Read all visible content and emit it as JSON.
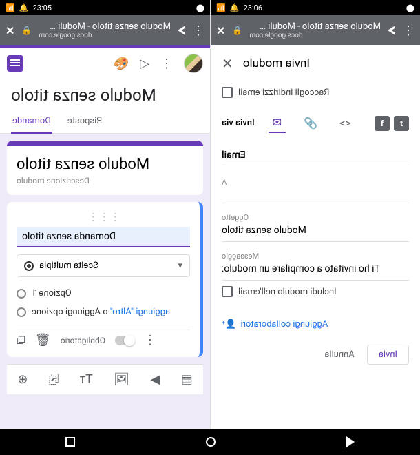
{
  "status": {
    "time_left": "23:06",
    "time_right": "23:05"
  },
  "browser": {
    "title": "Modulo senza titolo - Moduli …",
    "url": "docs.google.com"
  },
  "left": {
    "dialog_title": "Invia modulo",
    "collect_emails": "Raccogli indirizzi email",
    "send_via_label": "Invia via",
    "section": "Email",
    "to_label": "A",
    "to_value": "",
    "subject_label": "Oggetto",
    "subject_value": "Modulo senza titolo",
    "message_label": "Messaggio",
    "message_value": "Ti ho invitato a compilare un modulo:",
    "include_form": "Includi modulo nell'email",
    "add_collab": "Aggiungi collaboratori",
    "cancel": "Annulla",
    "send": "Invia"
  },
  "right": {
    "form_title": "Modulo senza titolo",
    "tab_questions": "Domande",
    "tab_responses": "Risposte",
    "card_title": "Modulo senza titolo",
    "card_desc": "Descrizione modulo",
    "question_title": "Domanda senza titolo",
    "question_type": "Scelta multipla",
    "option1": "Opzione 1",
    "add_option": "Aggiungi opzione",
    "or_word": " o ",
    "add_other": "aggiungi \"Altro\"",
    "required": "Obbligatorio"
  }
}
